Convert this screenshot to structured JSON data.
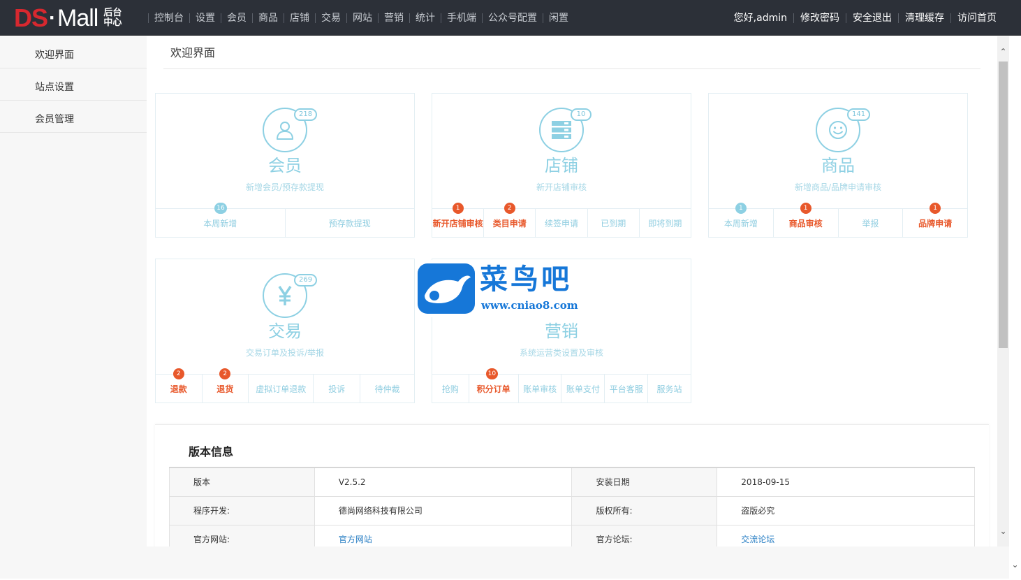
{
  "logo": {
    "brand_left": "DS",
    "brand_dot": "·",
    "brand_right": "Mall",
    "sub": "后台中心"
  },
  "main_nav": [
    "控制台",
    "设置",
    "会员",
    "商品",
    "店铺",
    "交易",
    "网站",
    "营销",
    "统计",
    "手机端",
    "公众号配置",
    "闲置"
  ],
  "user_nav": [
    "您好,admin",
    "修改密码",
    "安全退出",
    "清理缓存",
    "访问首页"
  ],
  "sidebar": {
    "items": [
      {
        "label": "欢迎界面"
      },
      {
        "label": "站点设置"
      },
      {
        "label": "会员管理"
      }
    ]
  },
  "page_title": "欢迎界面",
  "colors": {
    "accent": "#8dd0e3",
    "hot": "#e8582b",
    "topbar": "#2c3038",
    "brand_red": "#d7282f",
    "link": "#2a7fc4"
  },
  "cards": {
    "member": {
      "icon": "user-icon",
      "count": "218",
      "title": "会员",
      "desc": "新增会员/预存款提现",
      "links": [
        {
          "label": "本周新增",
          "badge": "16",
          "badge_color": "blue"
        },
        {
          "label": "预存款提现"
        }
      ]
    },
    "store": {
      "icon": "store-icon",
      "count": "10",
      "title": "店铺",
      "desc": "新开店铺审核",
      "links": [
        {
          "label": "新开店铺审核",
          "badge": "1",
          "badge_color": "orange"
        },
        {
          "label": "类目申请",
          "badge": "2",
          "badge_color": "orange"
        },
        {
          "label": "续签申请"
        },
        {
          "label": "已到期"
        },
        {
          "label": "即将到期"
        }
      ]
    },
    "goods": {
      "icon": "smile-icon",
      "count": "141",
      "title": "商品",
      "desc": "新增商品/品牌申请审核",
      "links": [
        {
          "label": "本周新增",
          "badge": "1",
          "badge_color": "blue"
        },
        {
          "label": "商品审核",
          "badge": "1",
          "badge_color": "orange"
        },
        {
          "label": "举报"
        },
        {
          "label": "品牌申请",
          "badge": "1",
          "badge_color": "orange"
        }
      ]
    },
    "trade": {
      "icon": "yen-icon",
      "count": "269",
      "title": "交易",
      "desc": "交易订单及投诉/举报",
      "links": [
        {
          "label": "退款",
          "badge": "2",
          "badge_color": "orange"
        },
        {
          "label": "退货",
          "badge": "2",
          "badge_color": "orange"
        },
        {
          "label": "虚拟订单退款"
        },
        {
          "label": "投诉"
        },
        {
          "label": "待仲裁"
        }
      ]
    },
    "marketing": {
      "title": "营销",
      "desc": "系统运营类设置及审核",
      "links": [
        {
          "label": "抢购"
        },
        {
          "label": "积分订单",
          "badge": "10",
          "badge_color": "orange"
        },
        {
          "label": "账单审核"
        },
        {
          "label": "账单支付"
        },
        {
          "label": "平台客服"
        },
        {
          "label": "服务站"
        }
      ]
    }
  },
  "version": {
    "title": "版本信息",
    "rows": [
      {
        "k1": "版本",
        "v1": "V2.5.2",
        "k2": "安装日期",
        "v2": "2018-09-15"
      },
      {
        "k1": "程序开发:",
        "v1": "德尚网络科技有限公司",
        "k2": "版权所有:",
        "v2": "盗版必究"
      },
      {
        "k1": "官方网站:",
        "v1": "官方网站",
        "k2": "官方论坛:",
        "v2": "交流论坛"
      }
    ]
  },
  "watermark": {
    "cn": "菜鸟吧",
    "url": "www.cniao8.com"
  }
}
